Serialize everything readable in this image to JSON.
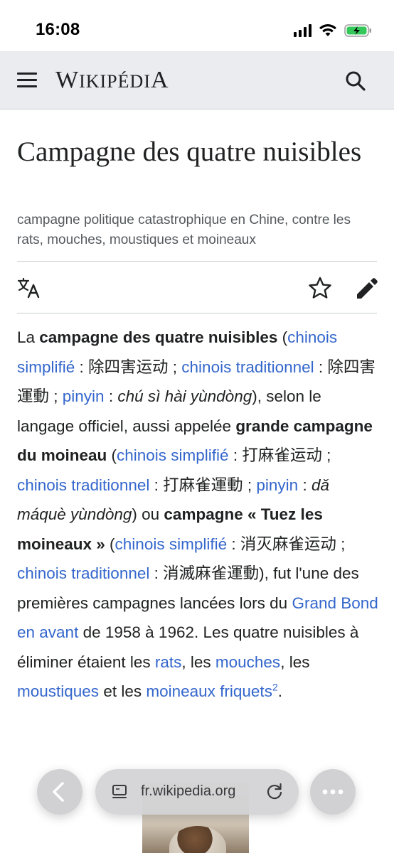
{
  "status_bar": {
    "time": "16:08",
    "icons": [
      "cellular-signal-icon",
      "wifi-icon",
      "battery-charging-icon"
    ],
    "battery_color": "#34c759"
  },
  "header": {
    "wordmark": {
      "w": "W",
      "ikip": "IKIP",
      "e": "É",
      "di": "DI",
      "a": "A"
    },
    "icons": [
      "menu-icon",
      "search-icon"
    ]
  },
  "article": {
    "title": "Campagne des quatre nuisibles",
    "description": "campagne politique catastrophique en Chine, contre les rats, mouches, moustiques et moineaux",
    "action_icons": [
      "language-icon",
      "star-icon",
      "edit-icon"
    ],
    "p": {
      "t1": "La ",
      "b1": "campagne des quatre nuisibles",
      "t2": " (",
      "l1": "chinois simplifié",
      "t3": " : 除四害运动 ; ",
      "l2": "chinois traditionnel",
      "t4": " : 除四害運動 ; ",
      "l3": "pinyin",
      "t5": " : ",
      "i1": "chú sì hài yùndòng",
      "t6": "), selon le langage officiel, aussi appelée ",
      "b2": "grande campagne du moineau",
      "t7": " (",
      "l4": "chinois simplifié",
      "t8": " : 打麻雀运动 ; ",
      "l5": "chinois traditionnel",
      "t9": " : 打麻雀運動 ; ",
      "l6": "pinyin",
      "t10": " : ",
      "i2": "dǎ máquè yùndòng",
      "t11": ") ou ",
      "b3": "campagne « Tuez les moineaux »",
      "t12": " (",
      "l7": "chinois simplifié",
      "t13": " : 消灭麻雀运动 ; ",
      "l8": "chinois traditionnel",
      "t14": " : 消滅麻雀運動), fut l'une des premières campagnes lancées lors du ",
      "l9": "Grand Bond en avant",
      "t15": " de 1958 à 1962. Les quatre nuisibles à éliminer étaient les ",
      "l10": "rats",
      "t16": ", les ",
      "l11": "mouches",
      "t17": ", les ",
      "l12": "moustiques",
      "t18": " et les ",
      "l13": "moineaux friquets",
      "sup": "2",
      "t19": "."
    },
    "link_color": "#3366cc"
  },
  "browser": {
    "url": "fr.wikipedia.org",
    "icons": [
      "back-icon",
      "tabs-icon",
      "reload-icon",
      "more-icon"
    ]
  }
}
